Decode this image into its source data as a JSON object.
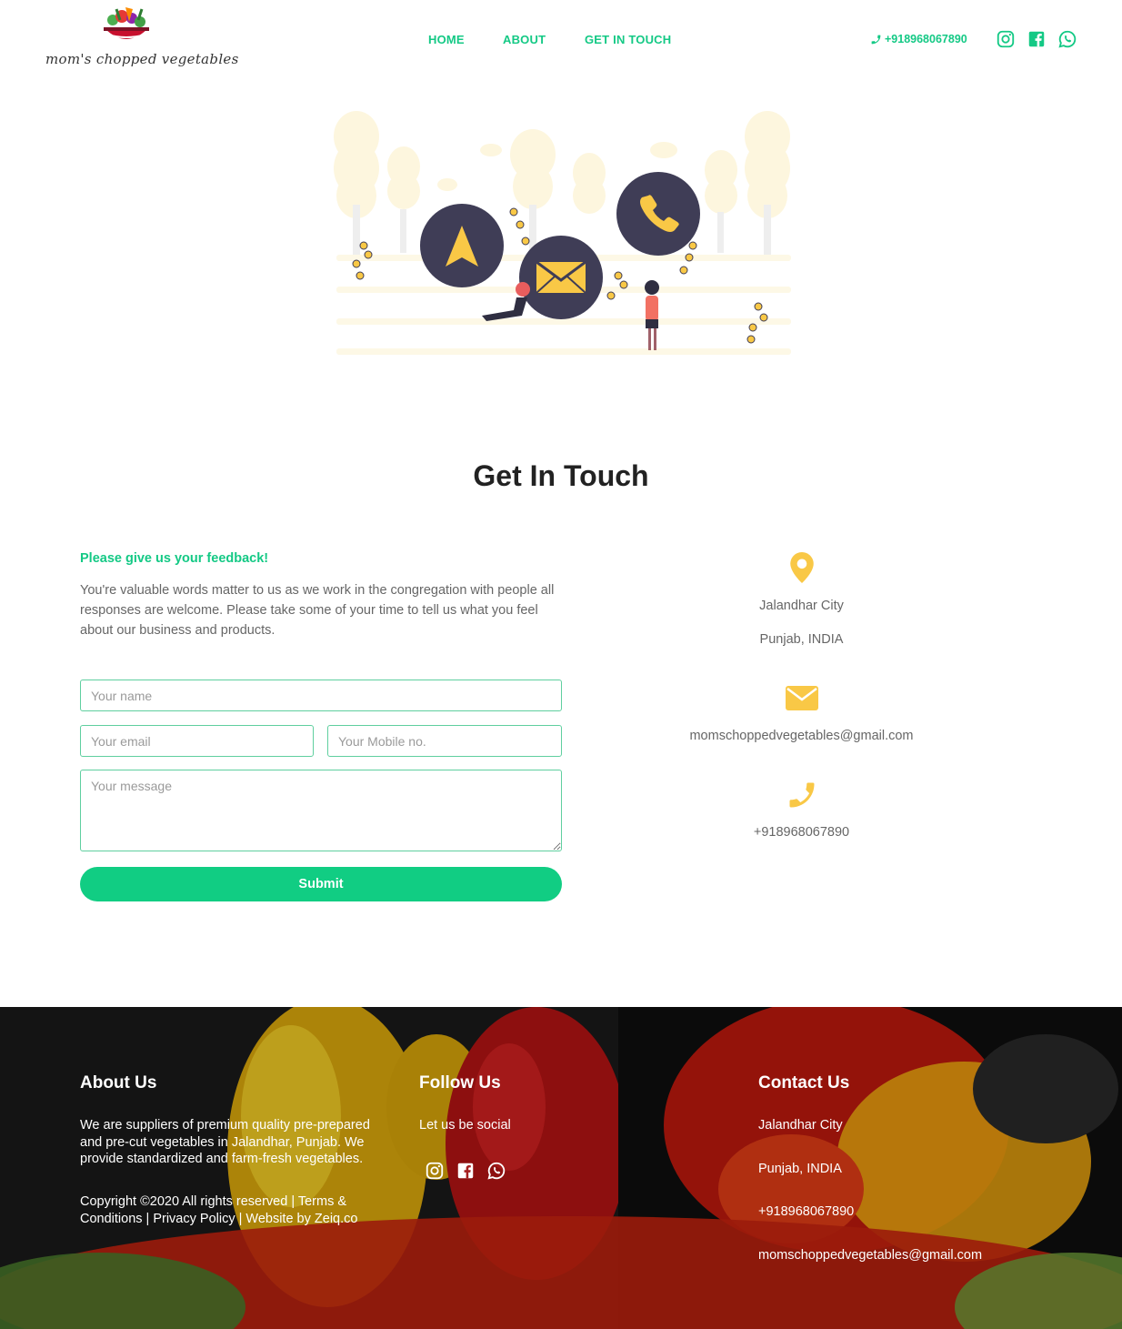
{
  "brand": {
    "logo_text": "mom's chopped vegetables"
  },
  "nav": {
    "home": "HOME",
    "about": "ABOUT",
    "contact": "GET IN TOUCH"
  },
  "header": {
    "phone": "+918968067890",
    "social_icons": [
      "instagram-icon",
      "facebook-icon",
      "whatsapp-icon"
    ]
  },
  "page": {
    "title": "Get In Touch"
  },
  "feedback": {
    "heading": "Please give us your feedback!",
    "text": "You're valuable words matter to us as we work in the congregation with people all responses are welcome. Please take some of your time to tell us what you feel about our business and products."
  },
  "form": {
    "name_placeholder": "Your name",
    "email_placeholder": "Your email",
    "mobile_placeholder": "Your Mobile no.",
    "message_placeholder": "Your message",
    "submit_label": "Submit"
  },
  "contact_info": {
    "city": "Jalandhar City",
    "state": "Punjab, INDIA",
    "email": "momschoppedvegetables@gmail.com",
    "phone": "+918968067890"
  },
  "footer": {
    "about_heading": "About Us",
    "about_text": "We are suppliers of premium quality pre-prepared and pre-cut vegetables in Jalandhar, Punjab. We provide standardized and farm-fresh vegetables.",
    "copyright": "Copyright ©2020 All rights reserved | Terms & Conditions | Privacy Policy | Website by Zeiq.co",
    "follow_heading": "Follow Us",
    "follow_text": "Let us be social",
    "contact_heading": "Contact Us",
    "city": "Jalandhar City",
    "state": "Punjab, INDIA",
    "phone": "+918968067890",
    "email": "momschoppedvegetables@gmail.com"
  },
  "colors": {
    "accent": "#14c985",
    "button": "#11cd83",
    "icon_yellow": "#f9c846",
    "dark_circle": "#3f3d56"
  }
}
